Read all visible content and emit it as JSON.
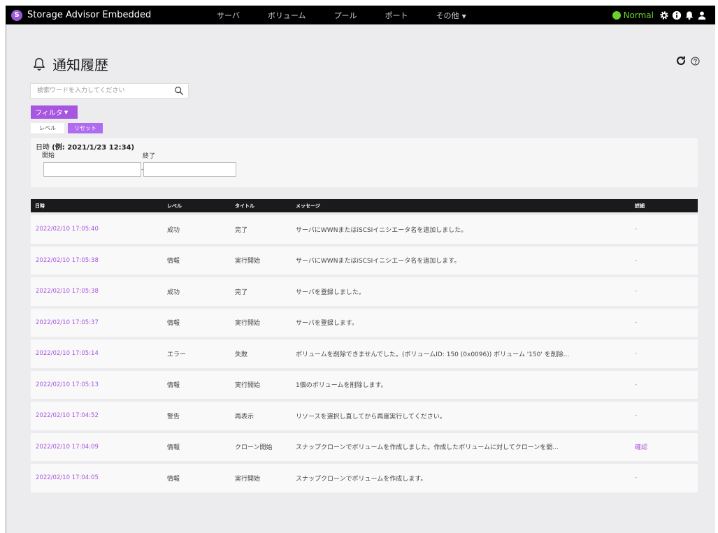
{
  "app": {
    "name": "Storage Advisor Embedded",
    "logo_letter": "S"
  },
  "nav": {
    "items": [
      {
        "label": "サーバ"
      },
      {
        "label": "ボリューム"
      },
      {
        "label": "プール"
      },
      {
        "label": "ポート"
      },
      {
        "label": "その他"
      }
    ]
  },
  "status": {
    "label": "Normal",
    "color": "#6bd12c"
  },
  "toolbar_icons": [
    "gear-icon",
    "info-icon",
    "bell-icon",
    "user-icon"
  ],
  "page": {
    "title": "通知履歴",
    "icon": "bell-outline-icon"
  },
  "search": {
    "placeholder": "検索ワードを入力してください"
  },
  "filter": {
    "button_label": "フィルタ",
    "level_chip": "レベル",
    "reset_chip": "リセット"
  },
  "date_filter": {
    "label": "日時",
    "example": "(例: 2021/1/23 12:34)",
    "start_label": "開始",
    "end_label": "終了",
    "separator": "-",
    "start_value": "",
    "end_value": ""
  },
  "table": {
    "headers": {
      "date": "日時",
      "level": "レベル",
      "title": "タイトル",
      "message": "メッセージ",
      "detail": "詳細"
    },
    "rows": [
      {
        "date": "2022/02/10 17:05:40",
        "level": "成功",
        "title": "完了",
        "message": "サーバにWWNまたはiSCSIイニシエータ名を追加しました。",
        "detail": "-"
      },
      {
        "date": "2022/02/10 17:05:38",
        "level": "情報",
        "title": "実行開始",
        "message": "サーバにWWNまたはiSCSIイニシエータ名を追加します。",
        "detail": "-"
      },
      {
        "date": "2022/02/10 17:05:38",
        "level": "成功",
        "title": "完了",
        "message": "サーバを登録しました。",
        "detail": "-"
      },
      {
        "date": "2022/02/10 17:05:37",
        "level": "情報",
        "title": "実行開始",
        "message": "サーバを登録します。",
        "detail": "-"
      },
      {
        "date": "2022/02/10 17:05:14",
        "level": "エラー",
        "title": "失敗",
        "message": "ボリュームを削除できませんでした。(ボリュームID: 150 (0x0096)) ボリューム '150' を削除...",
        "detail": "-"
      },
      {
        "date": "2022/02/10 17:05:13",
        "level": "情報",
        "title": "実行開始",
        "message": "1個のボリュームを削除します。",
        "detail": "-"
      },
      {
        "date": "2022/02/10 17:04:52",
        "level": "警告",
        "title": "再表示",
        "message": "リソースを選択し直してから再度実行してください。",
        "detail": "-"
      },
      {
        "date": "2022/02/10 17:04:09",
        "level": "情報",
        "title": "クローン開始",
        "message": "スナップクローンでボリュームを作成しました。作成したボリュームに対してクローンを開...",
        "detail": "確認"
      },
      {
        "date": "2022/02/10 17:04:05",
        "level": "情報",
        "title": "実行開始",
        "message": "スナップクローンでボリュームを作成します。",
        "detail": "-"
      }
    ]
  }
}
